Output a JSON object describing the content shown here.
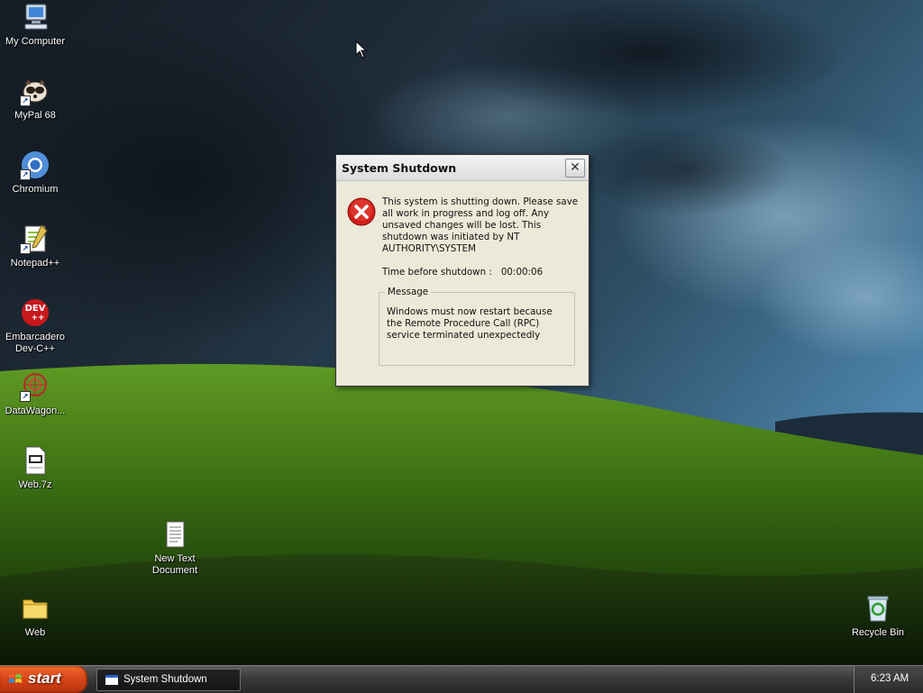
{
  "desktop_icons": [
    {
      "label": "My Computer",
      "icon": "computer-icon"
    },
    {
      "label": "MyPal 68",
      "icon": "mypal-browser-icon"
    },
    {
      "label": "Chromium",
      "icon": "chromium-icon"
    },
    {
      "label": "Notepad++",
      "icon": "notepadpp-icon"
    },
    {
      "label": "Embarcadero Dev-C++",
      "icon": "devcpp-icon"
    },
    {
      "label": "DataWagon...",
      "icon": "datawagon-icon"
    },
    {
      "label": "Web.7z",
      "icon": "archive-file-icon"
    },
    {
      "label": "New Text Document",
      "icon": "text-document-icon"
    },
    {
      "label": "Web",
      "icon": "folder-icon"
    },
    {
      "label": "Recycle Bin",
      "icon": "recycle-bin-icon"
    }
  ],
  "devcpp_badge": "DEV",
  "devcpp_plus": "++",
  "dialog": {
    "title": "System Shutdown",
    "close_glyph": "✕",
    "message_main": "This system is shutting down. Please save all work in progress and log off. Any unsaved changes will be lost. This shutdown was initiated by NT AUTHORITY\\SYSTEM",
    "time_label": "Time before shutdown :",
    "time_value": "00:00:06",
    "message_group_label": "Message",
    "message_body": "Windows must now restart because the Remote Procedure Call (RPC) service terminated unexpectedly"
  },
  "taskbar": {
    "start_label": "start",
    "task_label": "System Shutdown",
    "clock": "6:23 AM"
  },
  "colors": {
    "start_button": "#d8471a",
    "error_red": "#d2201c",
    "hill_green": "#4f8a1c",
    "sky_dark": "#1c2a36"
  }
}
